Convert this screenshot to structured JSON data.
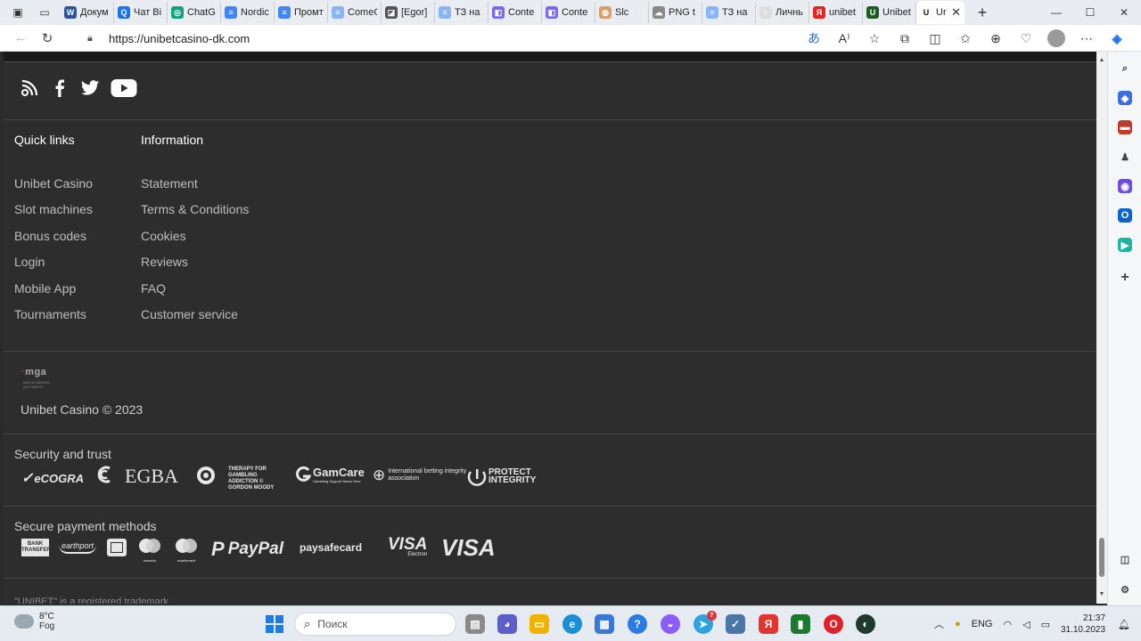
{
  "browser": {
    "tabs": [
      {
        "label": "Докум",
        "color": "#2b579a",
        "glyph": "W"
      },
      {
        "label": "Чат Bi",
        "color": "#1a73e8",
        "glyph": "Q"
      },
      {
        "label": "ChatG",
        "color": "#10a37f",
        "glyph": "◎"
      },
      {
        "label": "Nordic",
        "color": "#4285f4",
        "glyph": "≡"
      },
      {
        "label": "Промт",
        "color": "#4285f4",
        "glyph": "≡"
      },
      {
        "label": "ComeC",
        "color": "#8ab4f8",
        "glyph": "≡"
      },
      {
        "label": "[Egor]",
        "color": "#555555",
        "glyph": "◪"
      },
      {
        "label": "ТЗ на",
        "color": "#8ab4f8",
        "glyph": "≡"
      },
      {
        "label": "Conte",
        "color": "#7b68ee",
        "glyph": "◧"
      },
      {
        "label": "Conte",
        "color": "#7b68ee",
        "glyph": "◧"
      },
      {
        "label": "Slc",
        "color": "#d9a066",
        "glyph": "◍"
      },
      {
        "label": "PNG t",
        "color": "#888888",
        "glyph": "☁"
      },
      {
        "label": "ТЗ на",
        "color": "#8ab4f8",
        "glyph": "≡"
      },
      {
        "label": "Личнь",
        "color": "#dddddd",
        "glyph": "○"
      },
      {
        "label": "unibet",
        "color": "#e52620",
        "glyph": "Я"
      },
      {
        "label": "Unibet",
        "color": "#1b5e20",
        "glyph": "U"
      }
    ],
    "active_tab": {
      "label": "Ur",
      "close": "✕"
    },
    "new_tab": "+",
    "url": "https://unibetcasino-dk.com",
    "window_controls": {
      "minimize": "—",
      "maximize": "☐",
      "close": "✕"
    }
  },
  "footer": {
    "quick_links": {
      "title": "Quick links",
      "items": [
        "Unibet Casino",
        "Slot machines",
        "Bonus codes",
        "Login",
        "Mobile App",
        "Tournaments"
      ]
    },
    "information": {
      "title": "Information",
      "items": [
        "Statement",
        "Terms & Conditions",
        "Cookies",
        "Reviews",
        "FAQ",
        "Customer service"
      ]
    },
    "mga": {
      "logo": "mga",
      "sub": "MALTA GAMING AUTHORITY"
    },
    "copyright": "Unibet Casino © 2023",
    "security": {
      "title": "Security and trust",
      "logos": {
        "ecogra": "eCOGRA",
        "egba": "EGBA",
        "gordon_moody": "THERAPY FOR GAMBLING ADDICTION © GORDON MOODY",
        "gamcare": "GamCare",
        "gamcare_sub": "Gambling Support Starts Here",
        "ibia": "International betting integrity association",
        "protect": "PROTECT INTEGRITY"
      }
    },
    "payments": {
      "title": "Secure payment methods",
      "logos": {
        "bank": "BANK TRANSFER",
        "earthport": "earthport",
        "maestro": "maestro",
        "mastercard": "mastercard",
        "paypal": "PayPal",
        "paysafe": "paysafecard",
        "visa_electron": "VISA",
        "visa_electron_sub": "Electron",
        "visa": "VISA"
      }
    },
    "trademark": "\"UNIBET\" is a registered trademark"
  },
  "taskbar": {
    "weather_temp": "8°C",
    "weather_desc": "Fog",
    "search_placeholder": "Поиск",
    "telegram_badge": "7",
    "language": "ENG",
    "time": "21:37",
    "date": "31.10.2023"
  }
}
